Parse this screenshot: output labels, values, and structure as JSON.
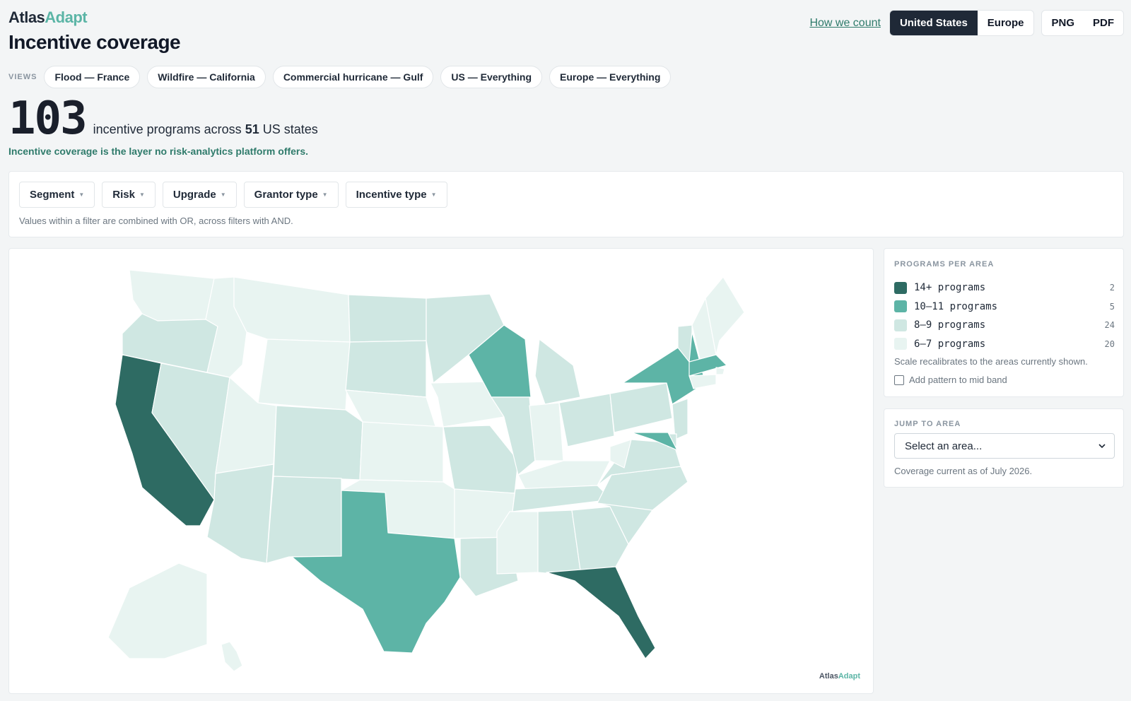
{
  "brand": {
    "part1": "Atlas",
    "part2": "Adapt"
  },
  "page_title": "Incentive coverage",
  "header": {
    "how_link": "How we count",
    "regions": [
      "United States",
      "Europe"
    ],
    "active_region": "United States",
    "exports": [
      "PNG",
      "PDF"
    ]
  },
  "views": {
    "label": "VIEWS",
    "items": [
      "Flood — France",
      "Wildfire — California",
      "Commercial hurricane — Gulf",
      "US — Everything",
      "Europe — Everything"
    ]
  },
  "stat": {
    "count": "103",
    "text_before": "incentive programs across",
    "areas": "51",
    "text_after": "US states",
    "tagline": "Incentive coverage is the layer no risk-analytics platform offers."
  },
  "filters": {
    "items": [
      "Segment",
      "Risk",
      "Upgrade",
      "Grantor type",
      "Incentive type"
    ],
    "note": "Values within a filter are combined with OR, across filters with AND."
  },
  "legend": {
    "heading": "PROGRAMS PER AREA",
    "bins": [
      {
        "label": "14+ programs",
        "count": "2",
        "color": "#2e6b63"
      },
      {
        "label": "10–11 programs",
        "count": "5",
        "color": "#5db4a6"
      },
      {
        "label": "8–9 programs",
        "count": "24",
        "color": "#cfe7e2"
      },
      {
        "label": "6–7 programs",
        "count": "20",
        "color": "#e8f4f1"
      }
    ],
    "scale_note": "Scale recalibrates to the areas currently shown.",
    "pattern_label": "Add pattern to mid band",
    "pattern_checked": false
  },
  "jump": {
    "heading": "JUMP TO AREA",
    "placeholder": "Select an area...",
    "coverage_note": "Coverage current as of July 2026."
  },
  "map": {
    "brand": {
      "part1": "Atlas",
      "part2": "Adapt"
    },
    "states": [
      {
        "name": "Washington",
        "bin": 3
      },
      {
        "name": "Oregon",
        "bin": 2
      },
      {
        "name": "California",
        "bin": 0
      },
      {
        "name": "Nevada",
        "bin": 2
      },
      {
        "name": "Idaho",
        "bin": 3
      },
      {
        "name": "Montana",
        "bin": 3
      },
      {
        "name": "Wyoming",
        "bin": 3
      },
      {
        "name": "Utah",
        "bin": 3
      },
      {
        "name": "Arizona",
        "bin": 2
      },
      {
        "name": "Colorado",
        "bin": 2
      },
      {
        "name": "New Mexico",
        "bin": 2
      },
      {
        "name": "North Dakota",
        "bin": 2
      },
      {
        "name": "South Dakota",
        "bin": 2
      },
      {
        "name": "Nebraska",
        "bin": 3
      },
      {
        "name": "Kansas",
        "bin": 3
      },
      {
        "name": "Oklahoma",
        "bin": 3
      },
      {
        "name": "Texas",
        "bin": 1
      },
      {
        "name": "Minnesota",
        "bin": 2
      },
      {
        "name": "Iowa",
        "bin": 3
      },
      {
        "name": "Missouri",
        "bin": 2
      },
      {
        "name": "Arkansas",
        "bin": 3
      },
      {
        "name": "Louisiana",
        "bin": 2
      },
      {
        "name": "Wisconsin",
        "bin": 1
      },
      {
        "name": "Illinois",
        "bin": 2
      },
      {
        "name": "Michigan",
        "bin": 2
      },
      {
        "name": "Indiana",
        "bin": 3
      },
      {
        "name": "Ohio",
        "bin": 2
      },
      {
        "name": "Kentucky",
        "bin": 3
      },
      {
        "name": "Tennessee",
        "bin": 2
      },
      {
        "name": "Mississippi",
        "bin": 3
      },
      {
        "name": "Alabama",
        "bin": 2
      },
      {
        "name": "Georgia",
        "bin": 2
      },
      {
        "name": "Florida",
        "bin": 0
      },
      {
        "name": "South Carolina",
        "bin": 2
      },
      {
        "name": "North Carolina",
        "bin": 2
      },
      {
        "name": "Virginia",
        "bin": 2
      },
      {
        "name": "West Virginia",
        "bin": 3
      },
      {
        "name": "Pennsylvania",
        "bin": 2
      },
      {
        "name": "New York",
        "bin": 1
      },
      {
        "name": "Vermont",
        "bin": 2
      },
      {
        "name": "New Hampshire",
        "bin": 3
      },
      {
        "name": "Maine",
        "bin": 3
      },
      {
        "name": "Massachusetts",
        "bin": 1
      },
      {
        "name": "Rhode Island",
        "bin": 3
      },
      {
        "name": "Connecticut",
        "bin": 3
      },
      {
        "name": "New Jersey",
        "bin": 2
      },
      {
        "name": "Delaware",
        "bin": 2
      },
      {
        "name": "Maryland",
        "bin": 1
      },
      {
        "name": "Alaska",
        "bin": 3
      },
      {
        "name": "Hawaii",
        "bin": 3
      }
    ]
  }
}
